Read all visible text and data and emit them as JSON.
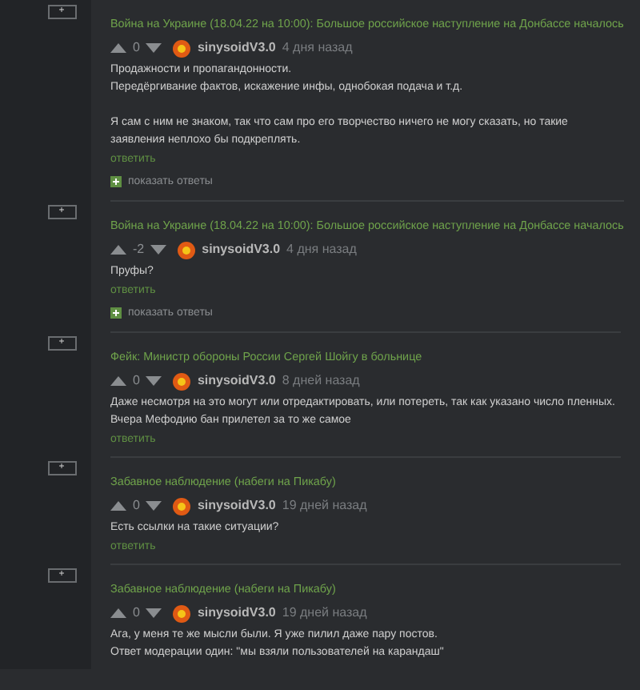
{
  "comments": [
    {
      "post_title": "Война на Украине (18.04.22 на 10:00): Большое российское наступление на Донбассе началось",
      "expand_label": "+",
      "score": "0",
      "user": "sinysoidV3.0",
      "date": "4 дня назад",
      "paragraphs": [
        "Продажности и пропагандонности.\nПередёргивание фактов, искажение инфы, однобокая подача и т.д.",
        "Я сам с ним не знаком, так что сам про его творчество ничего не могу сказать, но такие заявления неплохо бы подкреплять."
      ],
      "reply": "ответить",
      "show_replies": "показать ответы"
    },
    {
      "post_title": "Война на Украине (18.04.22 на 10:00): Большое российское наступление на Донбассе началось",
      "expand_label": "+",
      "score": "-2",
      "user": "sinysoidV3.0",
      "date": "4 дня назад",
      "paragraphs": [
        "Пруфы?"
      ],
      "reply": "ответить",
      "show_replies": "показать ответы"
    },
    {
      "post_title": "Фейк: Министр обороны России Сергей Шойгу в больнице",
      "expand_label": "+",
      "score": "0",
      "user": "sinysoidV3.0",
      "date": "8 дней назад",
      "paragraphs": [
        "Даже несмотря на это могут или отредактировать, или потереть, так как указано число пленных.\nВчера Мефодию бан прилетел за то же самое"
      ],
      "reply": "ответить"
    },
    {
      "post_title": "Забавное наблюдение (набеги на Пикабу)",
      "expand_label": "+",
      "score": "0",
      "user": "sinysoidV3.0",
      "date": "19 дней назад",
      "paragraphs": [
        "Есть ссылки на такие ситуации?"
      ],
      "reply": "ответить"
    },
    {
      "post_title": "Забавное наблюдение (набеги на Пикабу)",
      "expand_label": "+",
      "score": "0",
      "user": "sinysoidV3.0",
      "date": "19 дней назад",
      "paragraphs": [
        "Ага, у меня те же мысли были. Я уже пилил даже пару постов.\nОтвет модерации один: \"мы взяли пользователей на карандаш\""
      ]
    }
  ]
}
